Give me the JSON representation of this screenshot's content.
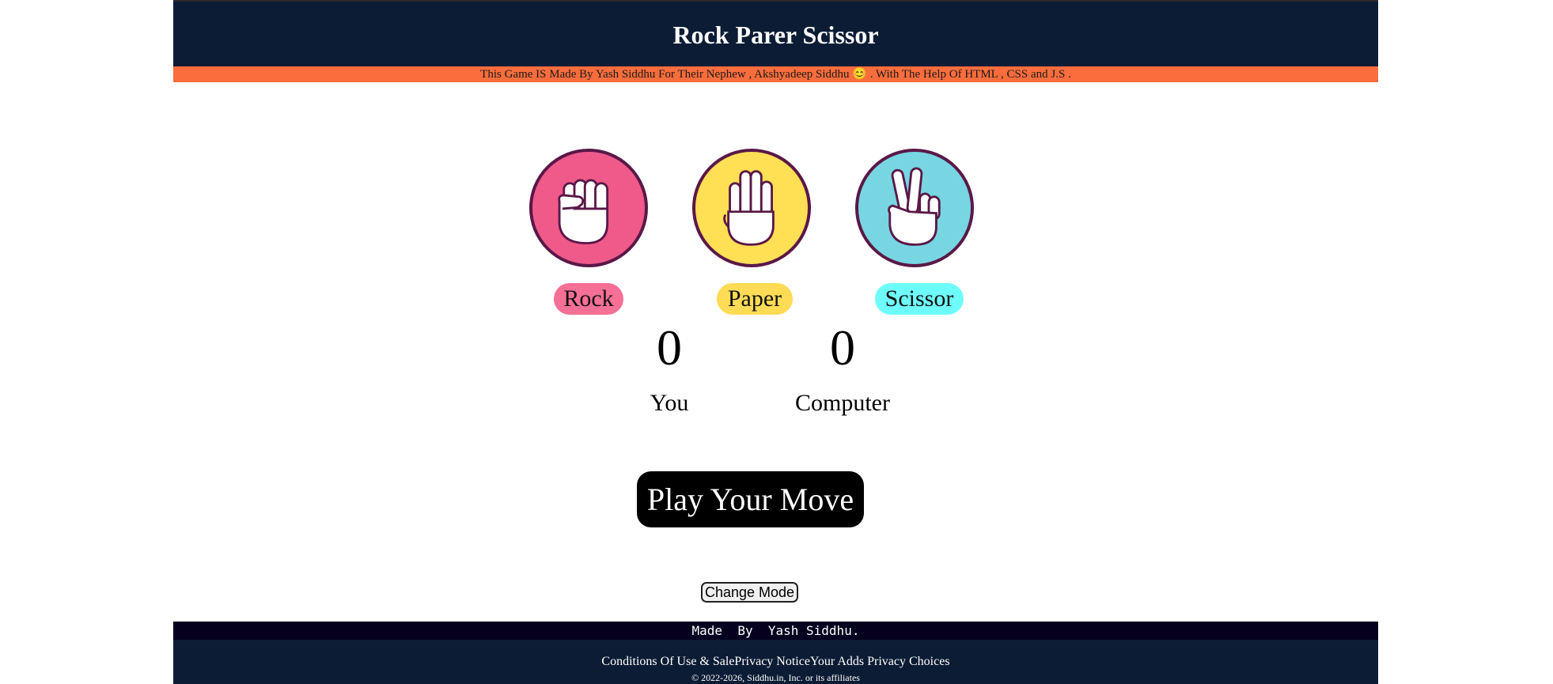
{
  "header": {
    "title": "Rock Parer Scissor",
    "notice": "This Game IS Made By Yash Siddhu For Their Nephew , Akshyadeep Siddhu 😊 . With The Help Of HTML , CSS and J.S ."
  },
  "choices": [
    {
      "label": "Rock",
      "icon": "fist-icon",
      "color": "#f05a8a",
      "label_bg": "#f66f95"
    },
    {
      "label": "Paper",
      "icon": "open-hand-icon",
      "color": "#ffdf54",
      "label_bg": "#ffdb56"
    },
    {
      "label": "Scissor",
      "icon": "peace-hand-icon",
      "color": "#77d6e2",
      "label_bg": "#6efcfb"
    }
  ],
  "score": {
    "you_value": "0",
    "you_label": "You",
    "computer_value": "0",
    "computer_label": "Computer"
  },
  "actions": {
    "play": "Play Your Move",
    "change_mode": "Change Mode"
  },
  "footer": {
    "made_by": "Made  By  Yash Siddhu.",
    "links": [
      "Conditions Of Use & Sale",
      "Privacy Notice",
      "Your Adds Privacy Choices"
    ],
    "copyright": "© 2022-2026, Siddhu.in, Inc. or its affiliates"
  }
}
